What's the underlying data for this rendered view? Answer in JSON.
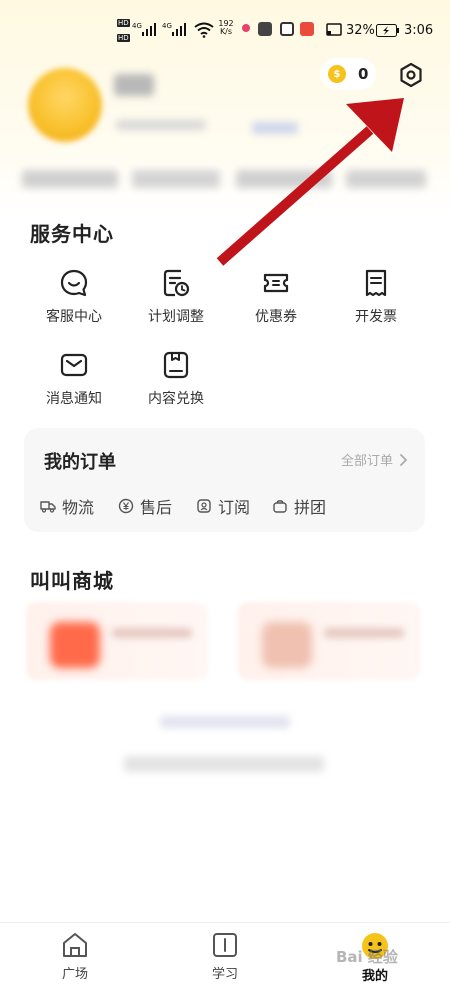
{
  "status_bar": {
    "network_speed_value": "192",
    "network_speed_unit": "K/s",
    "battery": "32%",
    "time": "3:06",
    "signal_label_1": "4G",
    "signal_label_2": "4G",
    "hd_label": "HD"
  },
  "profile": {
    "coin_count": "0",
    "coin_icon": "coin-icon",
    "settings_icon": "settings-icon"
  },
  "service_center": {
    "title": "服务中心",
    "items": [
      {
        "label": "客服中心",
        "icon": "chat-bubble-icon"
      },
      {
        "label": "计划调整",
        "icon": "plan-schedule-icon"
      },
      {
        "label": "优惠券",
        "icon": "coupon-icon"
      },
      {
        "label": "开发票",
        "icon": "invoice-icon"
      },
      {
        "label": "消息通知",
        "icon": "mail-icon"
      },
      {
        "label": "内容兑换",
        "icon": "exchange-icon"
      }
    ]
  },
  "orders": {
    "title": "我的订单",
    "all_label": "全部订单",
    "items": [
      {
        "label": "物流",
        "icon": "truck-icon"
      },
      {
        "label": "售后",
        "icon": "yuan-icon"
      },
      {
        "label": "订阅",
        "icon": "subscribe-icon"
      },
      {
        "label": "拼团",
        "icon": "bag-icon"
      }
    ]
  },
  "mall": {
    "title": "叫叫商城"
  },
  "tab_bar": {
    "items": [
      {
        "label": "广场",
        "icon": "home-icon",
        "active": false
      },
      {
        "label": "学习",
        "icon": "book-icon",
        "active": false
      },
      {
        "label": "我的",
        "icon": "avatar-face-icon",
        "active": true
      }
    ]
  },
  "watermark": "Bai 经验",
  "colors": {
    "accent_yellow": "#f6c21c",
    "annotation_red": "#c0141b",
    "card_bg": "#f7f7f7"
  }
}
